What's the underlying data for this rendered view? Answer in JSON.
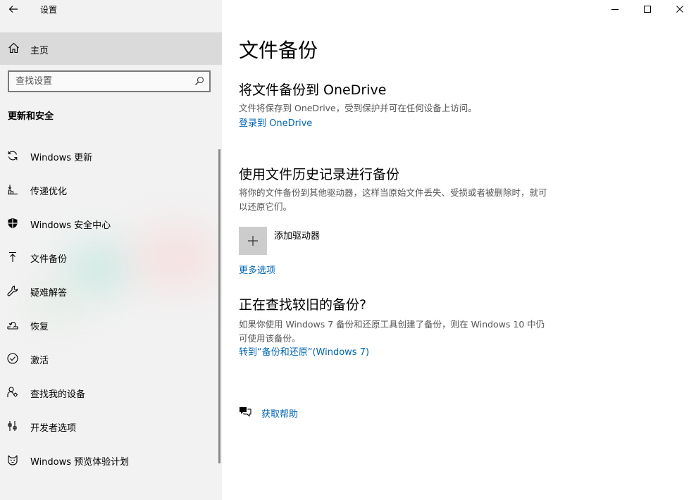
{
  "app": {
    "title": "设置"
  },
  "window_controls": {
    "minimize": "minimize-icon",
    "maximize": "maximize-icon",
    "close": "close-icon"
  },
  "sidebar": {
    "home_label": "主页",
    "search": {
      "placeholder": "查找设置",
      "value": ""
    },
    "section_title": "更新和安全",
    "items": [
      {
        "label": "Windows 更新",
        "icon": "sync-icon"
      },
      {
        "label": "传递优化",
        "icon": "delivery-optimization-icon"
      },
      {
        "label": "Windows 安全中心",
        "icon": "shield-icon"
      },
      {
        "label": "文件备份",
        "icon": "upload-arrow-icon",
        "selected": true
      },
      {
        "label": "疑难解答",
        "icon": "wrench-icon"
      },
      {
        "label": "恢复",
        "icon": "recovery-icon"
      },
      {
        "label": "激活",
        "icon": "check-circle-icon"
      },
      {
        "label": "查找我的设备",
        "icon": "person-locate-icon"
      },
      {
        "label": "开发者选项",
        "icon": "developer-tools-icon"
      },
      {
        "label": "Windows 预览体验计划",
        "icon": "insider-cat-icon"
      }
    ]
  },
  "main": {
    "title": "文件备份",
    "onedrive": {
      "heading": "将文件备份到 OneDrive",
      "description": "文件将保存到 OneDrive，受到保护并可在任何设备上访问。",
      "link": "登录到 OneDrive"
    },
    "file_history": {
      "heading": "使用文件历史记录进行备份",
      "description": "将你的文件备份到其他驱动器，这样当原始文件丢失、受损或者被删除时，就可以还原它们。",
      "add_drive_label": "添加驱动器",
      "more_options_link": "更多选项"
    },
    "older_backup": {
      "heading": "正在查找较旧的备份?",
      "description": "如果你使用 Windows 7 备份和还原工具创建了备份，则在 Windows 10 中仍可使用该备份。",
      "link": "转到“备份和还原”(Windows 7)"
    },
    "help_link": "获取帮助"
  },
  "colors": {
    "accent_link": "#0066b4",
    "sidebar_bg": "#f2f2f2",
    "home_selected_bg": "#dadada"
  }
}
